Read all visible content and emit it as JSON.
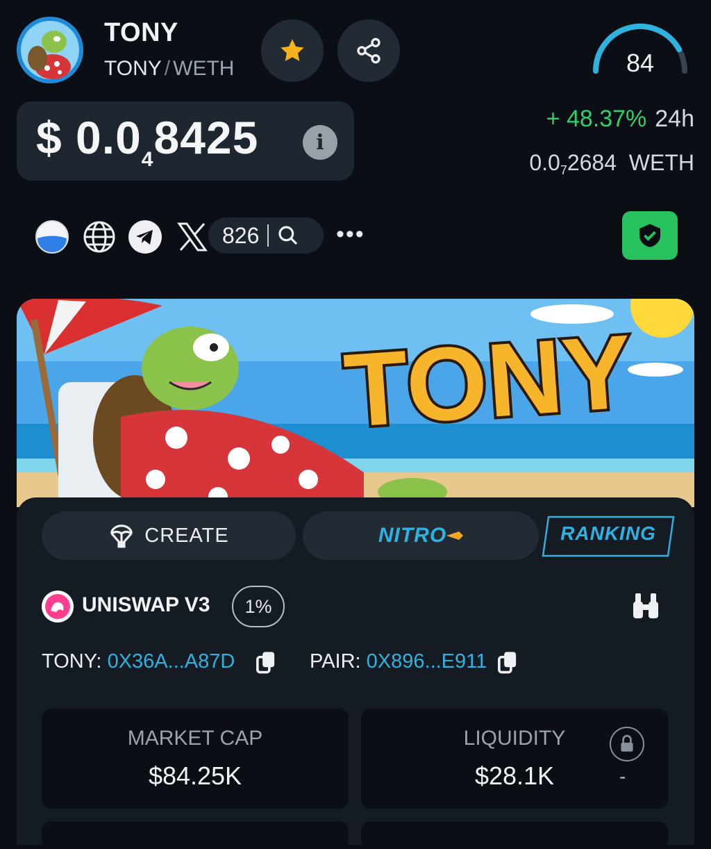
{
  "token": {
    "name": "TONY",
    "base": "TONY",
    "separator": "/",
    "quote": "WETH"
  },
  "score": {
    "value": "84",
    "level": 0.84
  },
  "price": {
    "prefix": "$ 0.0",
    "zeros": "4",
    "digits": "8425",
    "change": "+ 48.37%",
    "period": "24h",
    "weth_prefix": "0.0",
    "weth_zeros": "7",
    "weth_digits": "2684",
    "weth_unit": "WETH"
  },
  "social": {
    "x_followers": "826",
    "icons": [
      "globe-dex-icon",
      "website-icon",
      "telegram-icon",
      "x-icon",
      "search-icon",
      "more-icon"
    ]
  },
  "tabs": {
    "create": "CREATE",
    "nitro": "NITRO",
    "ranking": "RANKING"
  },
  "dex": {
    "name": "UNISWAP V3",
    "fee": "1%"
  },
  "addresses": {
    "token_label": "TONY:",
    "token_addr": "0X36A...A87D",
    "pair_label": "PAIR:",
    "pair_addr": "0X896...E911"
  },
  "stats": {
    "market_cap_label": "MARKET CAP",
    "market_cap_value": "$84.25K",
    "liquidity_label": "LIQUIDITY",
    "liquidity_value": "$28.1K",
    "liquidity_locked": "-"
  },
  "banner": {
    "text": "TONY"
  },
  "colors": {
    "accent_blue": "#2fb2e0",
    "positive_green": "#2fcf6b",
    "shield_green": "#27c25e",
    "star_gold": "#f5b21b"
  }
}
